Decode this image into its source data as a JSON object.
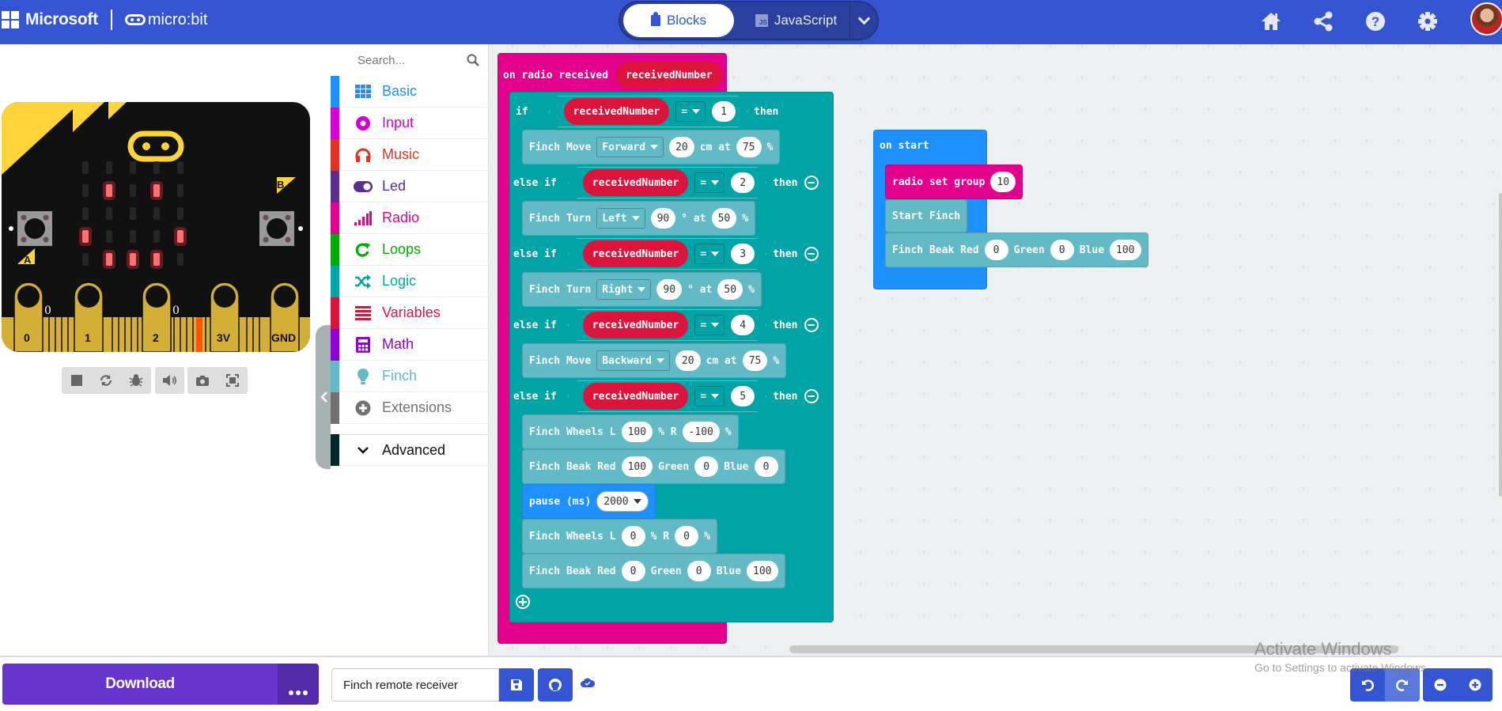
{
  "header": {
    "microsoft_label": "Microsoft",
    "microbit_label": "micro:bit",
    "tabs": [
      {
        "label": "Blocks",
        "active": true
      },
      {
        "label": "JavaScript",
        "active": false
      }
    ],
    "js_icon_text": "JS",
    "icons": [
      "home-icon",
      "share-icon",
      "help-icon",
      "settings-icon"
    ]
  },
  "simulator": {
    "pins": [
      "0",
      "1",
      "2",
      "3V",
      "GND"
    ],
    "pin_values": {
      "p0": "0",
      "p2": "0"
    },
    "button_a": "A",
    "button_b": "B",
    "led_matrix": [
      [
        0,
        0,
        0,
        0,
        0
      ],
      [
        0,
        1,
        0,
        1,
        0
      ],
      [
        0,
        0,
        0,
        0,
        0
      ],
      [
        1,
        0,
        0,
        0,
        1
      ],
      [
        0,
        1,
        1,
        1,
        0
      ]
    ],
    "controls": [
      "stop-icon",
      "restart-icon",
      "debug-icon",
      "mute-icon",
      "screenshot-icon",
      "fullscreen-icon"
    ]
  },
  "toolbox": {
    "search_placeholder": "Search...",
    "categories": [
      {
        "label": "Basic",
        "color": "#1e90ff",
        "icon": "grid-icon"
      },
      {
        "label": "Input",
        "color": "#d400d4",
        "icon": "input-icon"
      },
      {
        "label": "Music",
        "color": "#e63022",
        "icon": "headphones-icon"
      },
      {
        "label": "Led",
        "color": "#5c2d91",
        "icon": "toggle-icon"
      },
      {
        "label": "Radio",
        "color": "#e3008c",
        "icon": "signal-icon"
      },
      {
        "label": "Loops",
        "color": "#00aa00",
        "icon": "loop-icon"
      },
      {
        "label": "Logic",
        "color": "#00a4a6",
        "icon": "shuffle-icon"
      },
      {
        "label": "Variables",
        "color": "#dc143c",
        "icon": "lines-icon"
      },
      {
        "label": "Math",
        "color": "#9400d3",
        "icon": "calculator-icon"
      },
      {
        "label": "Finch",
        "color": "#62bac6",
        "icon": "bulb-icon"
      },
      {
        "label": "Extensions",
        "color": "#717171",
        "icon": "plus-circle-icon"
      }
    ],
    "advanced": {
      "label": "Advanced",
      "color": "#00272b"
    }
  },
  "colors": {
    "radio": "#e3008c",
    "logic": "#00a4a6",
    "finch": "#62bac6",
    "basic": "#1e90ff",
    "variable": "#dc143c",
    "brand": "#3454d1",
    "download": "#6633cc"
  },
  "workspace": {
    "radio_block": {
      "header": "on radio received",
      "param": "receivedNumber",
      "if_label": "if",
      "else_if_label": "else if",
      "then_label": "then",
      "operator": "=",
      "branches": [
        {
          "value": "1",
          "statements": [
            {
              "type": "move",
              "text": "Finch Move",
              "dir": "Forward",
              "dist": "20",
              "unit": "cm at",
              "speed": "75",
              "pct": "%"
            }
          ]
        },
        {
          "value": "2",
          "statements": [
            {
              "type": "turn",
              "text": "Finch Turn",
              "dir": "Left",
              "angle": "90",
              "unit": "° at",
              "speed": "50",
              "pct": "%"
            }
          ]
        },
        {
          "value": "3",
          "statements": [
            {
              "type": "turn",
              "text": "Finch Turn",
              "dir": "Right",
              "angle": "90",
              "unit": "° at",
              "speed": "50",
              "pct": "%"
            }
          ]
        },
        {
          "value": "4",
          "statements": [
            {
              "type": "move",
              "text": "Finch Move",
              "dir": "Backward",
              "dist": "20",
              "unit": "cm at",
              "speed": "75",
              "pct": "%"
            }
          ]
        },
        {
          "value": "5",
          "statements": [
            {
              "type": "wheels",
              "text": "Finch Wheels L",
              "l": "100",
              "mid": "% R",
              "r": "-100",
              "pct": "%"
            },
            {
              "type": "beak",
              "text": "Finch Beak Red",
              "red": "100",
              "g": "Green",
              "green": "0",
              "b": "Blue",
              "blue": "0"
            },
            {
              "type": "pause",
              "text": "pause (ms)",
              "ms": "2000"
            },
            {
              "type": "wheels",
              "text": "Finch Wheels L",
              "l": "0",
              "mid": "% R",
              "r": "0",
              "pct": "%"
            },
            {
              "type": "beak",
              "text": "Finch Beak Red",
              "red": "0",
              "g": "Green",
              "green": "0",
              "b": "Blue",
              "blue": "100"
            }
          ]
        }
      ]
    },
    "start_block": {
      "header": "on start",
      "radio_set_group": "radio set group",
      "group": "10",
      "start_finch": "Start Finch",
      "beak_text": "Finch Beak Red",
      "red": "0",
      "green_label": "Green",
      "green": "0",
      "blue_label": "Blue",
      "blue": "100"
    }
  },
  "bottombar": {
    "download_label": "Download",
    "project_name": "Finch remote receiver"
  },
  "watermark": {
    "line1": "Activate Windows",
    "line2": "Go to Settings to activate Windows."
  }
}
